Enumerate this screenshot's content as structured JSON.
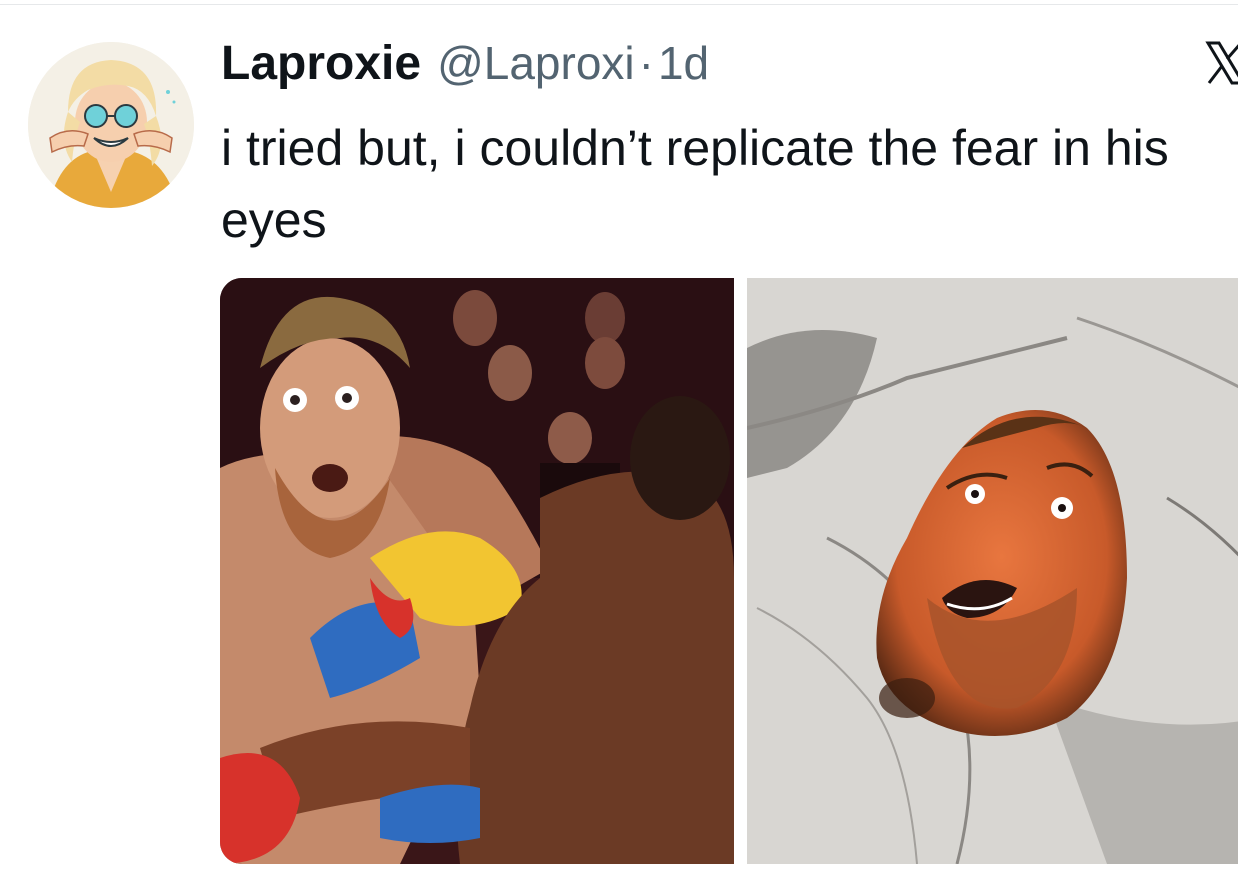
{
  "post": {
    "display_name": "Laproxie",
    "handle": "@Laproxi",
    "separator": "·",
    "time": "1d",
    "text": "i tried but, i couldn’t replicate the fear in his eyes"
  },
  "icons": {
    "platform": "x-logo-icon",
    "avatar": "avatar-image"
  },
  "media": [
    {
      "kind": "photo",
      "subject": "boxing-match-photo"
    },
    {
      "kind": "photo",
      "subject": "painted-rock-photo"
    }
  ],
  "colors": {
    "text_primary": "#0f1419",
    "text_secondary": "#536471",
    "background": "#ffffff",
    "divider": "#e6e8ea"
  }
}
